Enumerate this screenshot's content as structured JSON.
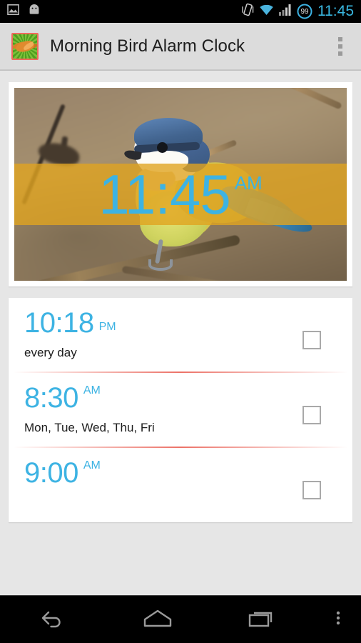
{
  "status_bar": {
    "icons": [
      "image-icon",
      "android-icon"
    ],
    "right_icons": [
      "vibrate-icon",
      "wifi-icon",
      "signal-icon"
    ],
    "battery_level": "99",
    "time": "11:45"
  },
  "action_bar": {
    "app_icon_name": "morning-bird-app-icon",
    "title": "Morning Bird Alarm Clock",
    "overflow_label": "⋮"
  },
  "clock_widget": {
    "time": "11:45",
    "ampm": "AM",
    "photo_alt": "blue tit bird perched on branch",
    "band_color": "#e0a420",
    "clock_color": "#3db3e3"
  },
  "alarms": [
    {
      "time": "10:18",
      "ampm": "PM",
      "days": "every day",
      "enabled": false
    },
    {
      "time": "8:30",
      "ampm": "AM",
      "days": "Mon, Tue, Wed, Thu, Fri",
      "enabled": false
    },
    {
      "time": "9:00",
      "ampm": "AM",
      "days": "",
      "enabled": false
    }
  ],
  "nav_bar": {
    "back_label": "back-button",
    "home_label": "home-button",
    "recents_label": "recents-button",
    "menu_label": "menu-button"
  },
  "colors": {
    "accent_blue": "#3db3e3",
    "status_time": "#39b7e0",
    "divider_red": "#e95a4e",
    "action_bar_bg": "#dcdcdc",
    "page_bg": "#e6e6e6"
  }
}
